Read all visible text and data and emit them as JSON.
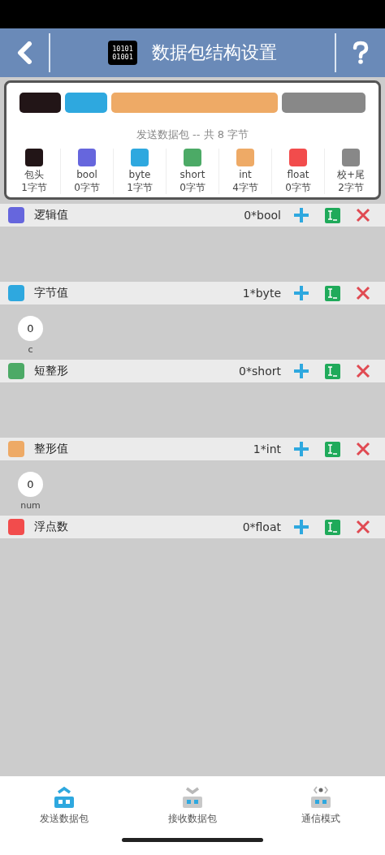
{
  "header": {
    "title": "数据包结构设置",
    "logo_lines": [
      "10101",
      "01001"
    ]
  },
  "summary": {
    "segments": [
      {
        "color": "#221517"
      },
      {
        "color": "#2ea8df"
      },
      {
        "color": "#eeaa66"
      },
      {
        "color": "#888888"
      }
    ],
    "caption": "发送数据包 -- 共 8 字节",
    "legend": [
      {
        "color": "#221517",
        "name": "包头",
        "bytes": "1字节"
      },
      {
        "color": "#6666dd",
        "name": "bool",
        "bytes": "0字节"
      },
      {
        "color": "#2ea8df",
        "name": "byte",
        "bytes": "1字节"
      },
      {
        "color": "#4caa66",
        "name": "short",
        "bytes": "0字节"
      },
      {
        "color": "#eeaa66",
        "name": "int",
        "bytes": "4字节"
      },
      {
        "color": "#f24c4c",
        "name": "float",
        "bytes": "0字节"
      },
      {
        "color": "#888888",
        "name": "校+尾",
        "bytes": "2字节"
      }
    ]
  },
  "sections": [
    {
      "color": "#6666dd",
      "title": "逻辑值",
      "count": "0*bool"
    },
    {
      "color": "#2ea8df",
      "title": "字节值",
      "count": "1*byte",
      "fields": [
        {
          "value": "0",
          "label": "c"
        }
      ]
    },
    {
      "color": "#4caa66",
      "title": "短整形",
      "count": "0*short"
    },
    {
      "color": "#eeaa66",
      "title": "整形值",
      "count": "1*int",
      "fields": [
        {
          "value": "0",
          "label": "num"
        }
      ]
    },
    {
      "color": "#f24c4c",
      "title": "浮点数",
      "count": "0*float"
    }
  ],
  "nav": [
    {
      "kind": "send",
      "label": "发送数据包",
      "selected": true
    },
    {
      "kind": "receive",
      "label": "接收数据包",
      "selected": false
    },
    {
      "kind": "mode",
      "label": "通信模式",
      "selected": false
    }
  ]
}
